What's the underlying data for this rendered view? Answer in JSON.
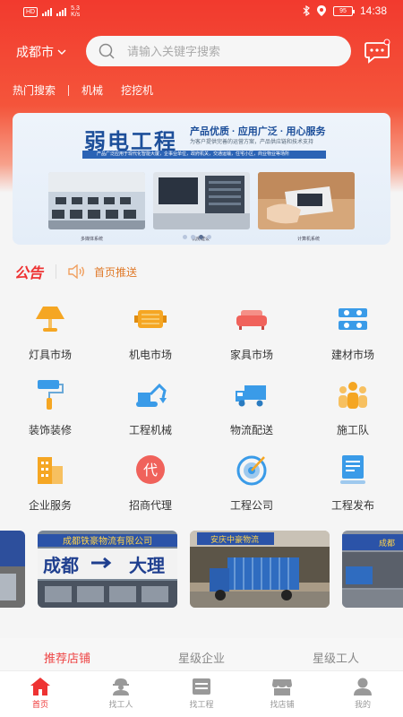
{
  "status": {
    "sim": "HD",
    "speed": "5.3",
    "speed_unit": "K/s",
    "battery": "95",
    "time": "14:38"
  },
  "header": {
    "city": "成都市",
    "search_placeholder": "请输入关键字搜索"
  },
  "hot": {
    "label": "热门搜索",
    "keywords": [
      "机械",
      "挖挖机"
    ]
  },
  "banner": {
    "title": "弱电工程",
    "slogan": "产品优质 · 应用广泛 · 用心服务",
    "subtitle": "为客户提供完善的运营方案，产品供应链和技术支持",
    "strip": "产品广泛应用于现代化智能大厦，企事业单位，政府机关，交通运输，住宅小区，商业物业等场所",
    "captions": [
      "多媒体系统",
      "机房建设",
      "计算机系统"
    ]
  },
  "notice": {
    "tag": "公告",
    "text": "首页推送"
  },
  "categories": [
    {
      "label": "灯具市场",
      "icon": "lamp-icon",
      "color": "#f5a623"
    },
    {
      "label": "机电市场",
      "icon": "motor-icon",
      "color": "#f5a623"
    },
    {
      "label": "家具市场",
      "icon": "sofa-icon",
      "color": "#f0625b"
    },
    {
      "label": "建材市场",
      "icon": "bricks-icon",
      "color": "#3a9be8"
    },
    {
      "label": "装饰装修",
      "icon": "paint-roller-icon",
      "color": "#3a9be8"
    },
    {
      "label": "工程机械",
      "icon": "excavator-icon",
      "color": "#3a9be8"
    },
    {
      "label": "物流配送",
      "icon": "truck-icon",
      "color": "#3a9be8"
    },
    {
      "label": "施工队",
      "icon": "team-icon",
      "color": "#f5a623"
    },
    {
      "label": "企业服务",
      "icon": "building-icon",
      "color": "#f5a623"
    },
    {
      "label": "招商代理",
      "icon": "agent-icon",
      "color": "#f0625b"
    },
    {
      "label": "工程公司",
      "icon": "target-icon",
      "color": "#3a9be8"
    },
    {
      "label": "工程发布",
      "icon": "publish-icon",
      "color": "#3a9be8"
    }
  ],
  "shops": [
    {
      "sign": "成都铁豪物流有限公司",
      "big": "成都",
      "big2": "大理"
    },
    {
      "sign": "安庆中豪物流"
    },
    {
      "sign": "成都"
    }
  ],
  "tabs": [
    "推荐店铺",
    "星级企业",
    "星级工人"
  ],
  "bottom_nav": [
    {
      "label": "首页",
      "icon": "home-icon"
    },
    {
      "label": "找工人",
      "icon": "worker-icon"
    },
    {
      "label": "找工程",
      "icon": "project-icon"
    },
    {
      "label": "找店铺",
      "icon": "shop-icon"
    },
    {
      "label": "我的",
      "icon": "profile-icon"
    }
  ]
}
